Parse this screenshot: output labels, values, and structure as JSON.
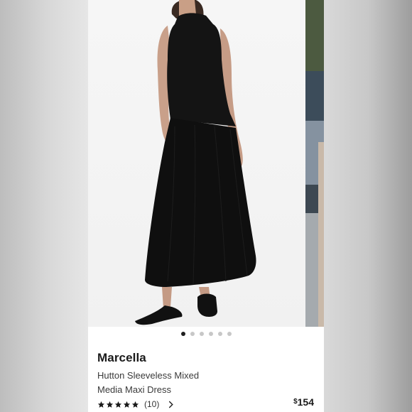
{
  "carousel": {
    "total_images": 6,
    "active_index": 0
  },
  "product": {
    "brand": "Marcella",
    "name": "Hutton Sleeveless Mixed Media Maxi Dress",
    "currency": "$",
    "price": "154",
    "rating": {
      "stars": 5,
      "count_text": "(10)"
    }
  },
  "icons": {
    "rating_star": "star-icon",
    "reviews_link": "chevron-right-icon"
  },
  "colors": {
    "dot_active": "#1f1f1f",
    "dot_inactive": "#c7c7c7",
    "star": "#1a1a1a"
  }
}
